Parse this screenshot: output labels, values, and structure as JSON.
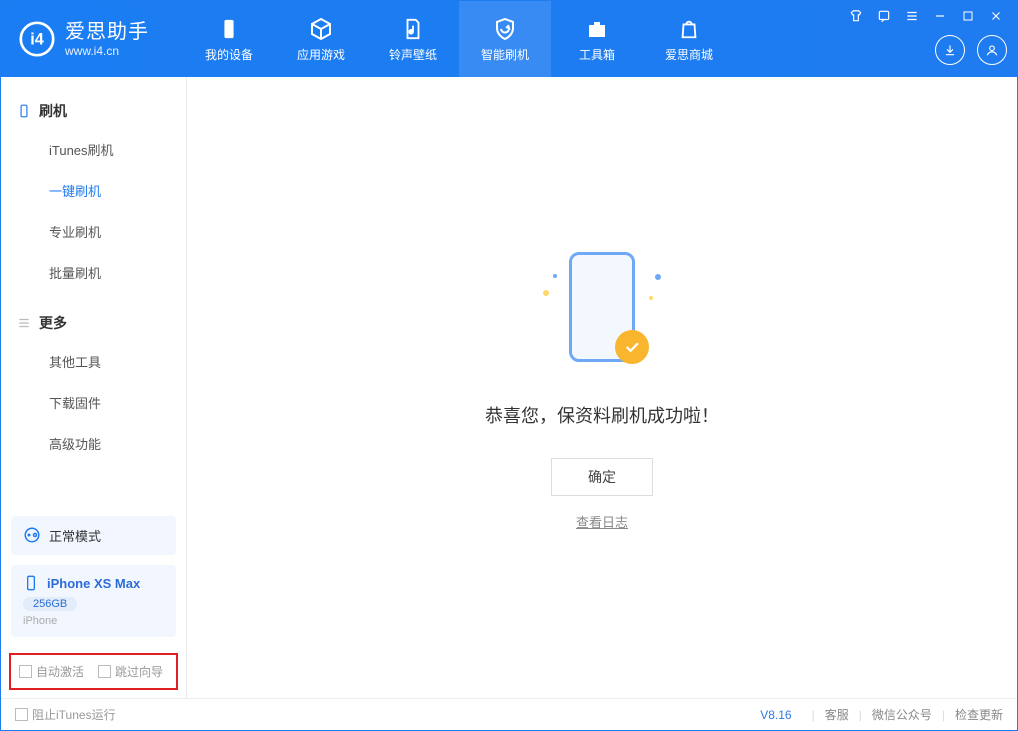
{
  "app": {
    "title": "爱思助手",
    "subtitle": "www.i4.cn"
  },
  "nav": {
    "items": [
      {
        "label": "我的设备"
      },
      {
        "label": "应用游戏"
      },
      {
        "label": "铃声壁纸"
      },
      {
        "label": "智能刷机"
      },
      {
        "label": "工具箱"
      },
      {
        "label": "爱思商城"
      }
    ]
  },
  "sidebar": {
    "section1": {
      "title": "刷机",
      "items": [
        "iTunes刷机",
        "一键刷机",
        "专业刷机",
        "批量刷机"
      ]
    },
    "section2": {
      "title": "更多",
      "items": [
        "其他工具",
        "下载固件",
        "高级功能"
      ]
    },
    "mode_label": "正常模式",
    "device": {
      "name": "iPhone XS Max",
      "storage": "256GB",
      "type": "iPhone"
    },
    "cb1": "自动激活",
    "cb2": "跳过向导"
  },
  "main": {
    "success_message": "恭喜您，保资料刷机成功啦！",
    "ok_button": "确定",
    "view_log": "查看日志"
  },
  "footer": {
    "block_itunes": "阻止iTunes运行",
    "version": "V8.16",
    "support": "客服",
    "wechat": "微信公众号",
    "update": "检查更新"
  }
}
